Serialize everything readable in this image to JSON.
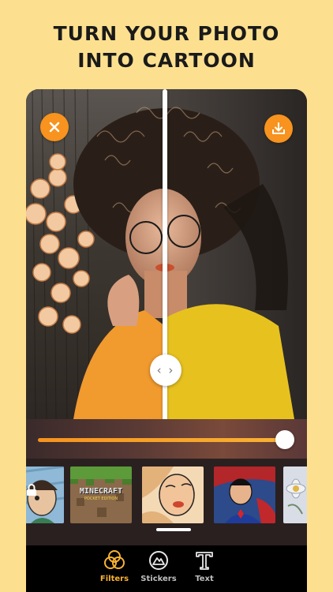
{
  "headline": {
    "line1": "TURN YOUR PHOTO",
    "line2": "INTO CARTOON"
  },
  "colors": {
    "background": "#FDE08F",
    "accent": "#F7931E",
    "active_tab": "#F9B233"
  },
  "editor": {
    "close_icon": "close-icon",
    "download_icon": "download-icon",
    "compare_handle_glyph": "‹ ›",
    "intensity": 0.92
  },
  "filters": {
    "thumbnails": [
      {
        "name": "locked-cartoon",
        "locked": true
      },
      {
        "name": "minecraft",
        "text": "MINECRAFT",
        "subtext": "POCKET EDITION"
      },
      {
        "name": "pop-art"
      },
      {
        "name": "comic-hero"
      },
      {
        "name": "floral"
      }
    ]
  },
  "tabs": [
    {
      "label": "Filters",
      "icon": "filters-icon",
      "active": true
    },
    {
      "label": "Stickers",
      "icon": "stickers-icon",
      "active": false
    },
    {
      "label": "Text",
      "icon": "text-icon",
      "active": false
    }
  ]
}
